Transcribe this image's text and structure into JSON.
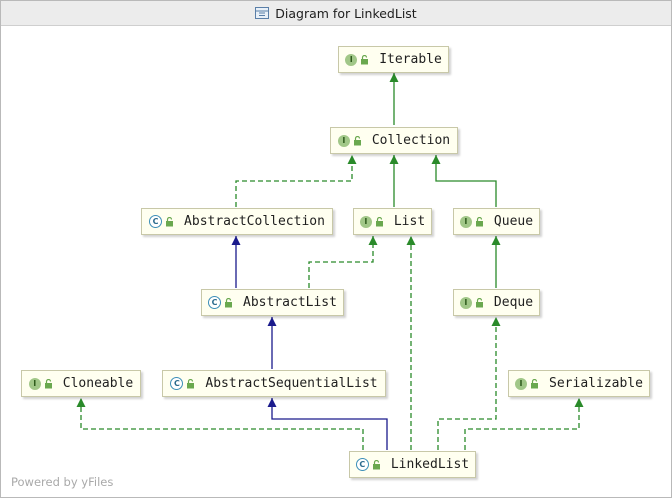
{
  "window": {
    "title": "Diagram for LinkedList"
  },
  "nodes": {
    "iterable": {
      "kind": "interface",
      "badge": "I",
      "label": "Iterable"
    },
    "collection": {
      "kind": "interface",
      "badge": "I",
      "label": "Collection"
    },
    "abstractcollection": {
      "kind": "class",
      "badge": "C",
      "label": "AbstractCollection"
    },
    "list": {
      "kind": "interface",
      "badge": "I",
      "label": "List"
    },
    "queue": {
      "kind": "interface",
      "badge": "I",
      "label": "Queue"
    },
    "abstractlist": {
      "kind": "class",
      "badge": "C",
      "label": "AbstractList"
    },
    "deque": {
      "kind": "interface",
      "badge": "I",
      "label": "Deque"
    },
    "cloneable": {
      "kind": "interface",
      "badge": "I",
      "label": "Cloneable"
    },
    "abstractsequentiallist": {
      "kind": "class",
      "badge": "C",
      "label": "AbstractSequentialList"
    },
    "serializable": {
      "kind": "interface",
      "badge": "I",
      "label": "Serializable"
    },
    "linkedlist": {
      "kind": "class",
      "badge": "C",
      "label": "LinkedList"
    }
  },
  "edges": [
    {
      "from": "Collection",
      "to": "Iterable",
      "type": "extends-interface"
    },
    {
      "from": "AbstractCollection",
      "to": "Collection",
      "type": "implements"
    },
    {
      "from": "List",
      "to": "Collection",
      "type": "extends-interface"
    },
    {
      "from": "Queue",
      "to": "Collection",
      "type": "extends-interface"
    },
    {
      "from": "AbstractList",
      "to": "AbstractCollection",
      "type": "extends-class"
    },
    {
      "from": "AbstractList",
      "to": "List",
      "type": "implements"
    },
    {
      "from": "Deque",
      "to": "Queue",
      "type": "extends-interface"
    },
    {
      "from": "AbstractSequentialList",
      "to": "AbstractList",
      "type": "extends-class"
    },
    {
      "from": "LinkedList",
      "to": "AbstractSequentialList",
      "type": "extends-class"
    },
    {
      "from": "LinkedList",
      "to": "Cloneable",
      "type": "implements"
    },
    {
      "from": "LinkedList",
      "to": "List",
      "type": "implements"
    },
    {
      "from": "LinkedList",
      "to": "Deque",
      "type": "implements"
    },
    {
      "from": "LinkedList",
      "to": "Serializable",
      "type": "implements"
    }
  ],
  "colors": {
    "interface_edge": "#2a8a2a",
    "class_edge": "#1a1a8c",
    "node_fill": "#fffff0"
  },
  "watermark": "Powered by yFiles"
}
